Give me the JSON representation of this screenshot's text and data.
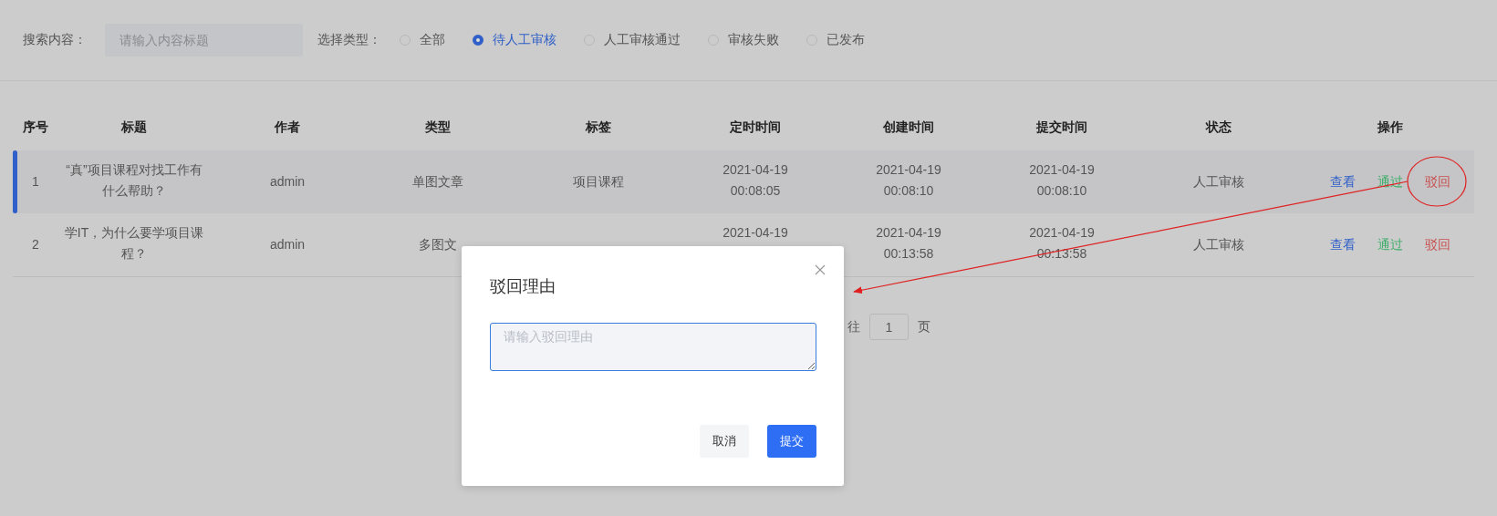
{
  "search": {
    "label": "搜索内容：",
    "placeholder": "请输入内容标题"
  },
  "filter": {
    "label": "选择类型：",
    "options": [
      {
        "label": "全部",
        "selected": false
      },
      {
        "label": "待人工审核",
        "selected": true
      },
      {
        "label": "人工审核通过",
        "selected": false
      },
      {
        "label": "审核失败",
        "selected": false
      },
      {
        "label": "已发布",
        "selected": false
      }
    ]
  },
  "table": {
    "columns": [
      "序号",
      "标题",
      "作者",
      "类型",
      "标签",
      "定时时间",
      "创建时间",
      "提交时间",
      "状态",
      "操作"
    ],
    "rows": [
      {
        "index": "1",
        "title": [
          "“真”项目课程对找工作有",
          "什么帮助？"
        ],
        "author": "admin",
        "type": "单图文章",
        "tag": "项目课程",
        "scheduled": [
          "2021-04-19",
          "00:08:05"
        ],
        "created": [
          "2021-04-19",
          "00:08:10"
        ],
        "submitted": [
          "2021-04-19",
          "00:08:10"
        ],
        "status": "人工审核",
        "highlighted": true,
        "actions": [
          {
            "label": "查看",
            "kind": "view"
          },
          {
            "label": "通过",
            "kind": "approve"
          },
          {
            "label": "驳回",
            "kind": "reject"
          }
        ]
      },
      {
        "index": "2",
        "title": [
          "学IT，为什么要学项目课",
          "程？"
        ],
        "author": "admin",
        "type": "多图文",
        "scheduled": [
          "2021-04-19"
        ],
        "created": [
          "2021-04-19",
          "00:13:58"
        ],
        "submitted": [
          "2021-04-19",
          "00:13:58"
        ],
        "status": "人工审核",
        "highlighted": false,
        "actions": [
          {
            "label": "查看",
            "kind": "view"
          },
          {
            "label": "通过",
            "kind": "approve"
          },
          {
            "label": "驳回",
            "kind": "reject"
          }
        ]
      }
    ]
  },
  "pagination": {
    "goto_label": "往",
    "page": "1",
    "suffix": "页"
  },
  "dialog": {
    "title": "驳回理由",
    "placeholder": "请输入驳回理由",
    "buttons": [
      {
        "label": "取消",
        "kind": "secondary"
      },
      {
        "label": "提交",
        "kind": "primary"
      }
    ]
  }
}
